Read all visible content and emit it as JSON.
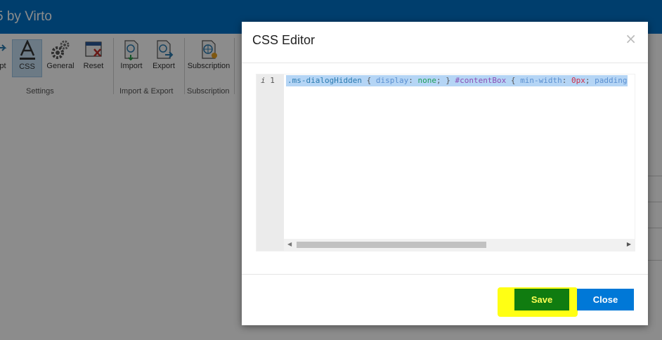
{
  "app": {
    "title": "5 by Virto",
    "ribbon": {
      "buttons": [
        {
          "label": "pt",
          "icon": "script-icon"
        },
        {
          "label": "CSS",
          "icon": "css-icon"
        },
        {
          "label": "General",
          "icon": "gears-icon"
        },
        {
          "label": "Reset",
          "icon": "reset-icon"
        },
        {
          "label": "Import",
          "icon": "import-icon"
        },
        {
          "label": "Export",
          "icon": "export-icon"
        },
        {
          "label": "Subscription",
          "icon": "subscription-icon"
        }
      ],
      "groups": {
        "settings": "Settings",
        "import_export": "Import & Export",
        "subscription": "Subscription"
      }
    }
  },
  "dialog": {
    "title": "CSS Editor",
    "close_glyph": "×",
    "editor": {
      "line_number": "1",
      "line_marker": "i",
      "tokens": [
        {
          "text": ".ms-dialogHidden",
          "kind": "sel"
        },
        {
          "text": " { ",
          "kind": "punct"
        },
        {
          "text": "display",
          "kind": "prop"
        },
        {
          "text": ": ",
          "kind": "punct"
        },
        {
          "text": "none",
          "kind": "val"
        },
        {
          "text": "; }  ",
          "kind": "punct"
        },
        {
          "text": "#contentBox",
          "kind": "id"
        },
        {
          "text": " {  ",
          "kind": "punct"
        },
        {
          "text": "min-width",
          "kind": "prop"
        },
        {
          "text": ": ",
          "kind": "punct"
        },
        {
          "text": "0px",
          "kind": "num"
        },
        {
          "text": "; ",
          "kind": "punct"
        },
        {
          "text": "padding",
          "kind": "prop"
        }
      ]
    },
    "buttons": {
      "save": "Save",
      "close": "Close"
    }
  },
  "colors": {
    "top_bar": "#0072c6",
    "save_button": "#107c10",
    "close_button": "#0078d7",
    "highlight": "#ffff14"
  }
}
